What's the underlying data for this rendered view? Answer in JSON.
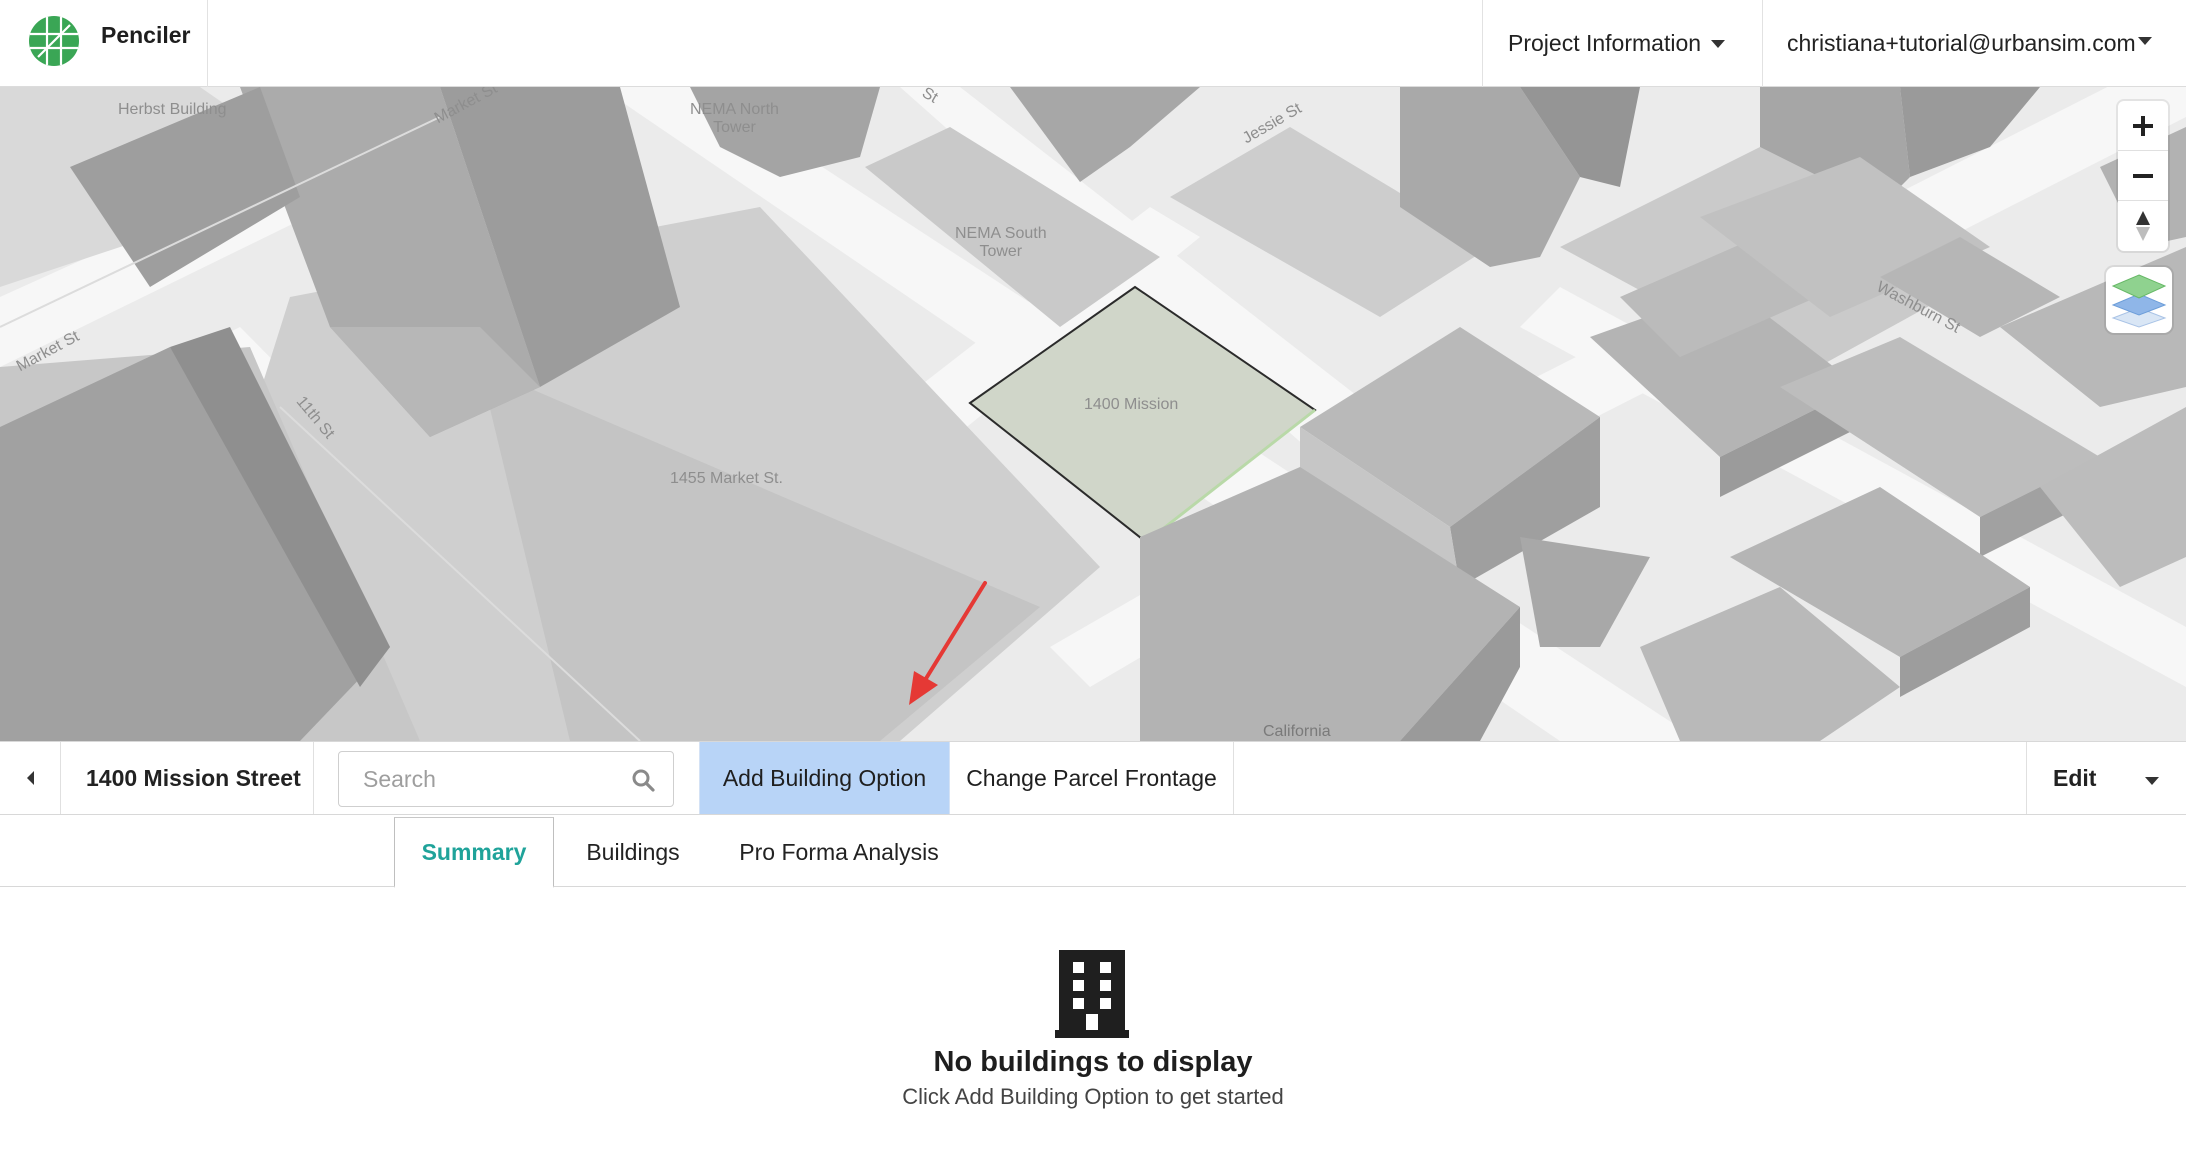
{
  "header": {
    "app_name": "Penciler",
    "project_menu": "Project Information",
    "user_email": "christiana+tutorial@urbansim.com"
  },
  "map": {
    "labels": {
      "herbst": "Herbst Building",
      "market_st_top": "Market St",
      "nema_north": "NEMA North\nTower",
      "st_top": "St",
      "jessie": "Jessie St",
      "nema_south": "NEMA South\nTower",
      "washburn": "Washburn St",
      "market_st_left": "Market St",
      "eleventh": "11th St",
      "mission_1400": "1400 Mission",
      "market_1455": "1455 Market St.",
      "california": "California"
    },
    "controls": {
      "zoom_in": "+",
      "zoom_out": "−"
    }
  },
  "toolbar": {
    "parcel_name": "1400 Mission Street",
    "search_placeholder": "Search",
    "add_building_option": "Add Building Option",
    "change_parcel_frontage": "Change Parcel Frontage",
    "edit": "Edit"
  },
  "tabs": [
    {
      "label": "Summary",
      "active": true
    },
    {
      "label": "Buildings",
      "active": false
    },
    {
      "label": "Pro Forma Analysis",
      "active": false
    }
  ],
  "empty_state": {
    "title": "No buildings to display",
    "subtitle": "Click Add Building Option to get started"
  },
  "colors": {
    "accent_teal": "#1fa39a",
    "add_button_bg": "#b8d4f7",
    "logo_green": "#3aa655",
    "annotation_arrow": "#e53935"
  }
}
